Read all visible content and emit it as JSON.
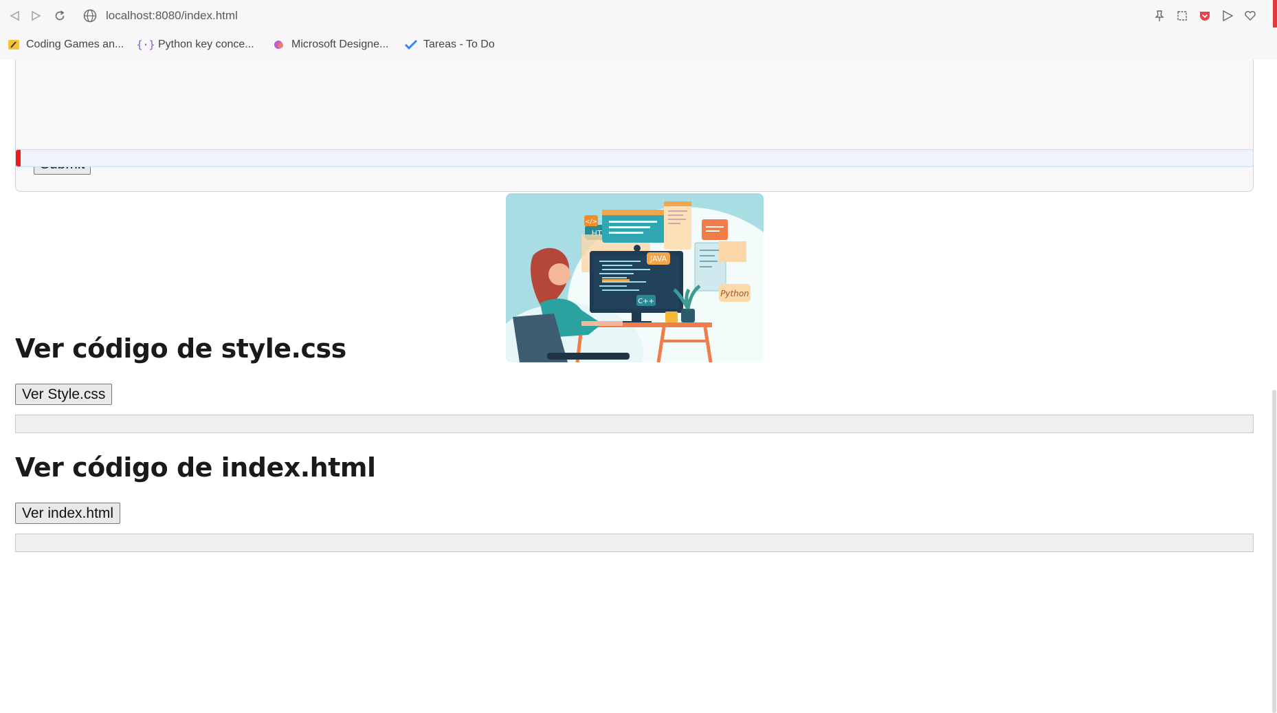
{
  "browser": {
    "url": "localhost:8080/index.html",
    "bookmarks": [
      {
        "label": "Coding Games an...",
        "icon": "coding-games-icon"
      },
      {
        "label": "Python key conce...",
        "icon": "curly-braces-icon"
      },
      {
        "label": "Microsoft Designe...",
        "icon": "microsoft-designer-icon"
      },
      {
        "label": "Tareas - To Do",
        "icon": "todo-check-icon"
      }
    ]
  },
  "form": {
    "submit_label": "Submit"
  },
  "progress": {
    "value": 0.004,
    "fill_color": "#ee1c1c"
  },
  "illustration": {
    "labels": [
      "HTML",
      "JAVA",
      "C++",
      "Python"
    ]
  },
  "sections": {
    "style": {
      "heading": "Ver código de style.css",
      "button_label": "Ver Style.css"
    },
    "index": {
      "heading": "Ver código de index.html",
      "button_label": "Ver index.html"
    }
  }
}
